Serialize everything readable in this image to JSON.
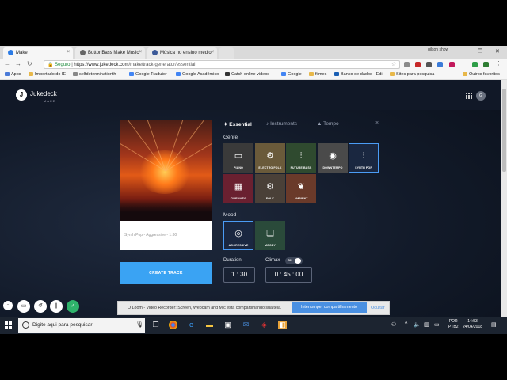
{
  "browser": {
    "tabs": [
      {
        "label": "Make",
        "icon_color": "#2c7be5"
      },
      {
        "label": "ButtonBass Make Music",
        "icon_color": "#666"
      },
      {
        "label": "Música no ensino médio",
        "icon_color": "#3b5998"
      }
    ],
    "user_label": "gilson show",
    "secure_label": "Seguro",
    "url_prefix": "https://www.jukedeck.com",
    "url_path": "/make/track-generator/essential",
    "bookmarks": [
      "Apps",
      "Importado do IE",
      "selfdeterminationth",
      "Google Tradutor",
      "Google Acadêmico",
      "Catch online videos",
      "Google",
      "filmes",
      "Banco de dados - Edi",
      "Sites para pesquisa",
      "Outros favoritos"
    ]
  },
  "app": {
    "brand": "Jukedeck",
    "brand_sub": "MAKE",
    "logo_glyph": "J",
    "avatar": "G"
  },
  "cover": {
    "caption": "Synth Pop - Aggressive - 1:30"
  },
  "create_label": "CREATE TRACK",
  "panel": {
    "tabs": [
      {
        "label": "Essential",
        "icon": "star-icon"
      },
      {
        "label": "Instruments",
        "icon": "guitar-icon"
      },
      {
        "label": "Tempo",
        "icon": "metronome-icon"
      }
    ],
    "close": "×",
    "genre_title": "Genre",
    "genres": [
      {
        "label": "PIANO",
        "icon": "piano-icon",
        "bg": "#3a3a3a",
        "selected": false
      },
      {
        "label": "ELECTRO FOLK",
        "icon": "gear-icon",
        "bg": "#6a5a3a",
        "selected": false
      },
      {
        "label": "FUTURE BASS",
        "icon": "sliders-icon",
        "bg": "#2f4a2f",
        "selected": false
      },
      {
        "label": "DOWNTEMPO",
        "icon": "speaker-icon",
        "bg": "#4a4a4a",
        "selected": false
      },
      {
        "label": "SYNTH POP",
        "icon": "sliders-icon",
        "bg": "#1a2740",
        "selected": true
      },
      {
        "label": "CINEMATIC",
        "icon": "grid-icon",
        "bg": "#6a2030",
        "selected": false
      },
      {
        "label": "FOLK",
        "icon": "gear-icon",
        "bg": "#4a4038",
        "selected": false
      },
      {
        "label": "AMBIENT",
        "icon": "feather-icon",
        "bg": "#6a3a2a",
        "selected": false
      }
    ],
    "mood_title": "Mood",
    "moods": [
      {
        "label": "AGGRESSIVE",
        "icon": "speaker-icon",
        "bg": "#1a2740",
        "selected": true
      },
      {
        "label": "MOODY",
        "icon": "chat-icon",
        "bg": "#2a4a3a",
        "selected": false
      }
    ],
    "duration_title": "Duration",
    "duration": {
      "min": "1",
      "sep": ":",
      "sec": "30"
    },
    "climax_title": "Climax",
    "climax_toggle": "ON",
    "climax": {
      "h": "0",
      "m": "45",
      "s": "00"
    }
  },
  "loom": {
    "text": "O Loom - Video Recorder: Screen, Webcam and Mic está compartilhando sua tela.",
    "stop": "Interromper compartilhamento",
    "hide": "Ocultar"
  },
  "taskbar": {
    "search_placeholder": "Digite aqui para pesquisar",
    "lang1": "POR",
    "lang2": "PTB2",
    "time": "14:53",
    "date": "24/04/2018"
  }
}
